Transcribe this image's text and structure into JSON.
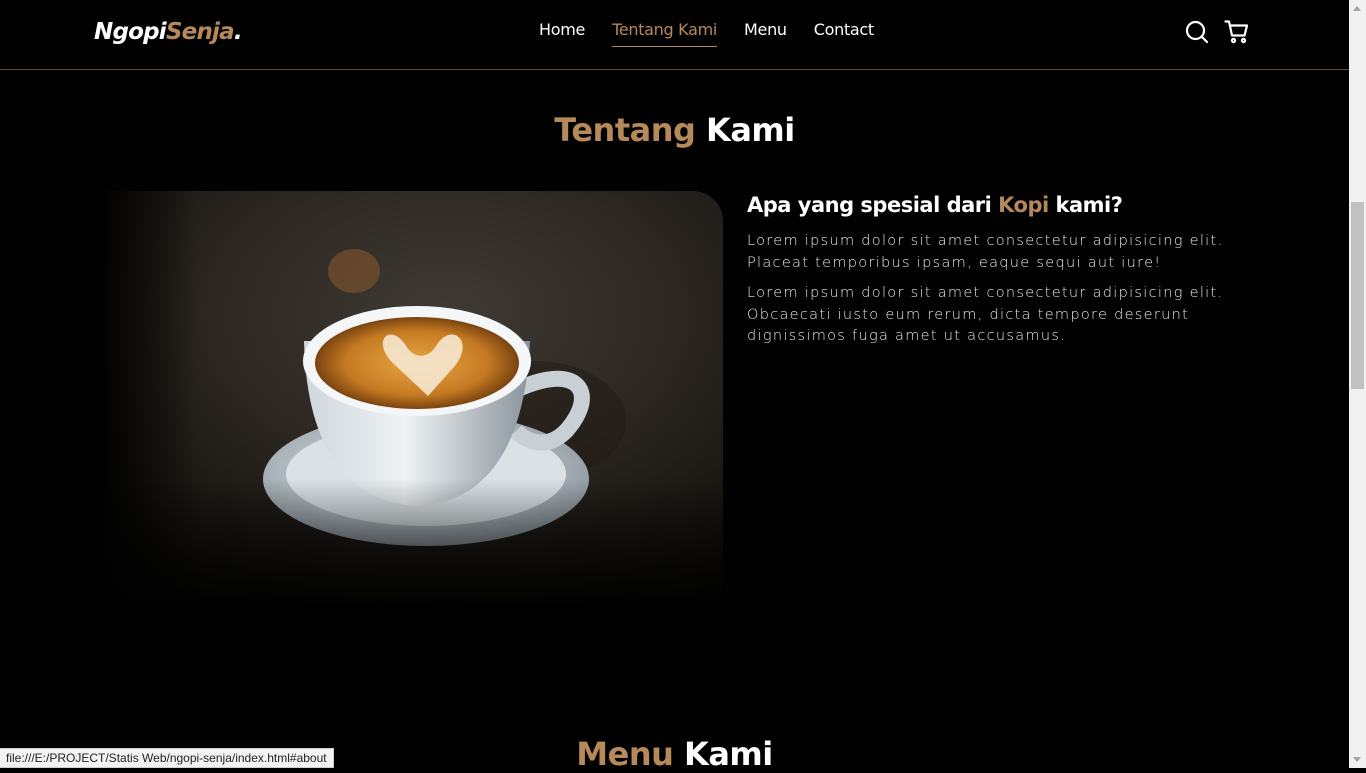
{
  "navbar": {
    "logo": {
      "part1": "Ngopi",
      "part2": "Senja",
      "dot": "."
    },
    "links": [
      {
        "label": "Home"
      },
      {
        "label": "Tentang Kami",
        "active": true
      },
      {
        "label": "Menu"
      },
      {
        "label": "Contact"
      }
    ],
    "icons": [
      "search-icon",
      "shopping-cart-icon"
    ]
  },
  "about": {
    "title": {
      "accent": "Tentang",
      "rest": " Kami"
    },
    "heading": {
      "before": "Apa yang spesial dari ",
      "accent": "Kopi",
      "after": " kami?"
    },
    "paragraphs": [
      "Lorem ipsum dolor sit amet consectetur adipisicing elit. Placeat temporibus ipsam, eaque sequi aut iure!",
      "Lorem ipsum dolor sit amet consectetur adipisicing elit. Obcaecati iusto eum rerum, dicta tempore deserunt dignissimos fuga amet ut accusamus."
    ]
  },
  "menu_section": {
    "title": {
      "accent": "Menu",
      "rest": " Kami"
    }
  },
  "status_bar": {
    "url": "file:///E:/PROJECT/Statis Web/ngopi-senja/index.html#about"
  },
  "colors": {
    "accent": "#b6895b",
    "background": "#010101",
    "text": "#ffffff"
  }
}
